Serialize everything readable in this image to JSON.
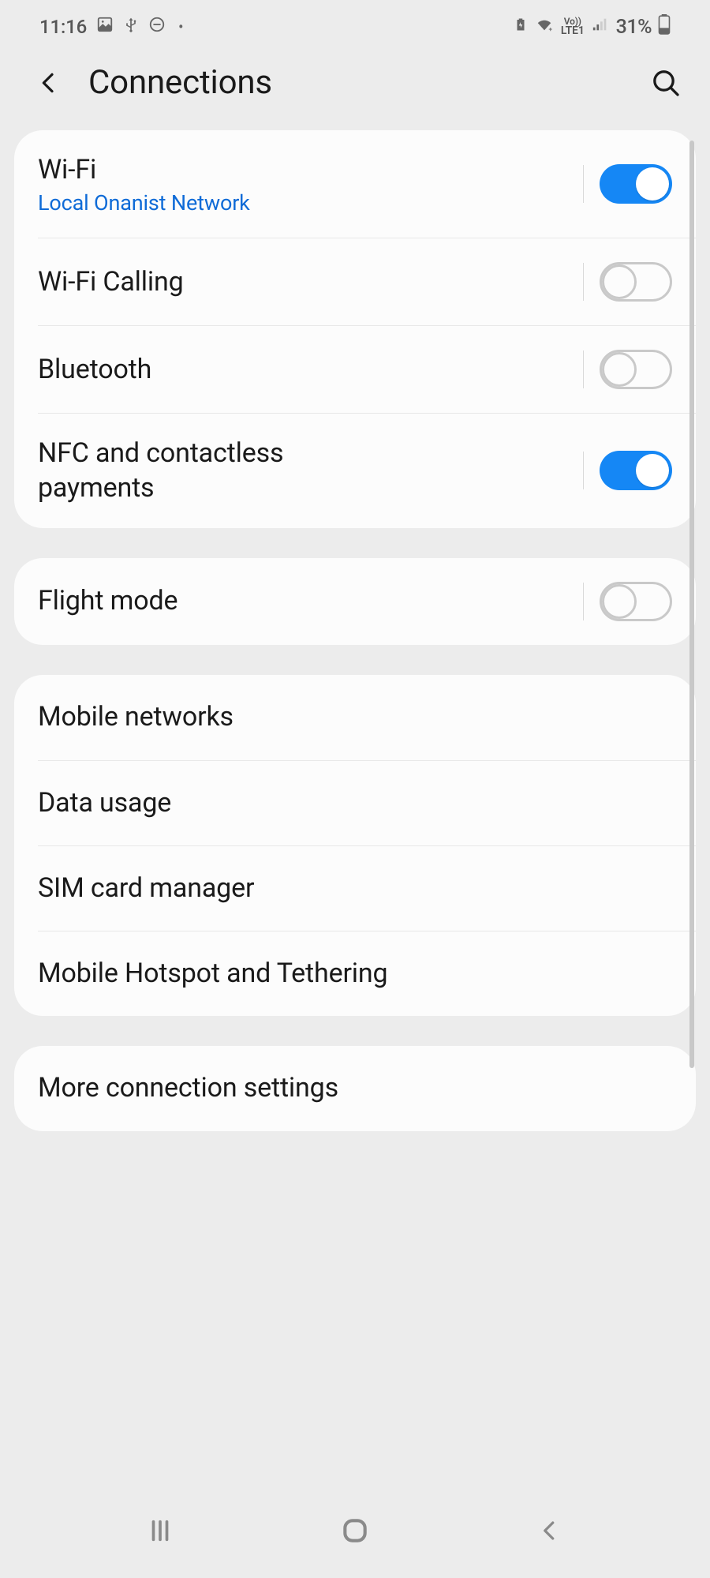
{
  "status": {
    "time": "11:16",
    "battery_text": "31%",
    "lte_label": "LTE1",
    "vo_label": "Vo))"
  },
  "header": {
    "title": "Connections"
  },
  "group1": {
    "wifi": {
      "title": "Wi-Fi",
      "sub": "Local Onanist Network",
      "on": true
    },
    "wifi_calling": {
      "title": "Wi-Fi Calling",
      "on": false
    },
    "bluetooth": {
      "title": "Bluetooth",
      "on": false
    },
    "nfc": {
      "title": "NFC and contactless payments",
      "on": true
    }
  },
  "group2": {
    "flight_mode": {
      "title": "Flight mode",
      "on": false
    }
  },
  "group3": {
    "mobile_networks": {
      "title": "Mobile networks"
    },
    "data_usage": {
      "title": "Data usage"
    },
    "sim_manager": {
      "title": "SIM card manager"
    },
    "hotspot": {
      "title": "Mobile Hotspot and Tethering"
    }
  },
  "group4": {
    "more": {
      "title": "More connection settings"
    }
  }
}
